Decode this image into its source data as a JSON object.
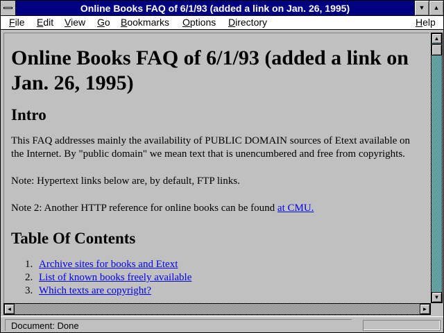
{
  "window": {
    "title": "Online Books FAQ of 6/1/93 (added a link on Jan. 26, 1995)"
  },
  "menubar": {
    "items": [
      {
        "ul": "F",
        "rest": "ile"
      },
      {
        "ul": "E",
        "rest": "dit"
      },
      {
        "ul": "V",
        "rest": "iew"
      },
      {
        "ul": "G",
        "rest": "o"
      },
      {
        "ul": "B",
        "rest": "ookmarks"
      },
      {
        "ul": "O",
        "rest": "ptions"
      },
      {
        "ul": "D",
        "rest": "irectory"
      },
      {
        "ul": "H",
        "rest": "elp"
      }
    ]
  },
  "content": {
    "heading": "Online Books FAQ of 6/1/93 (added a link on Jan. 26, 1995)",
    "intro_heading": "Intro",
    "intro_paragraph": "This FAQ addresses mainly the availability of PUBLIC DOMAIN sources of Etext available on the Internet. By \"public domain\" we mean text that is unencumbered and free from copyrights.",
    "note1": "Note: Hypertext links below are, by default, FTP links.",
    "note2_text": "Note 2: Another HTTP reference for online books can be found ",
    "note2_link": "at CMU.",
    "toc_heading": "Table Of Contents",
    "toc": [
      {
        "num": "1.",
        "label": "Archive sites for books and Etext"
      },
      {
        "num": "2.",
        "label": "List of known books freely available"
      },
      {
        "num": "3.",
        "label": "Which texts are copyright?"
      }
    ]
  },
  "status": {
    "text": "Document: Done"
  },
  "colors": {
    "titlebar": "#000080",
    "link": "#0000ee",
    "background": "#c0c0c0"
  }
}
